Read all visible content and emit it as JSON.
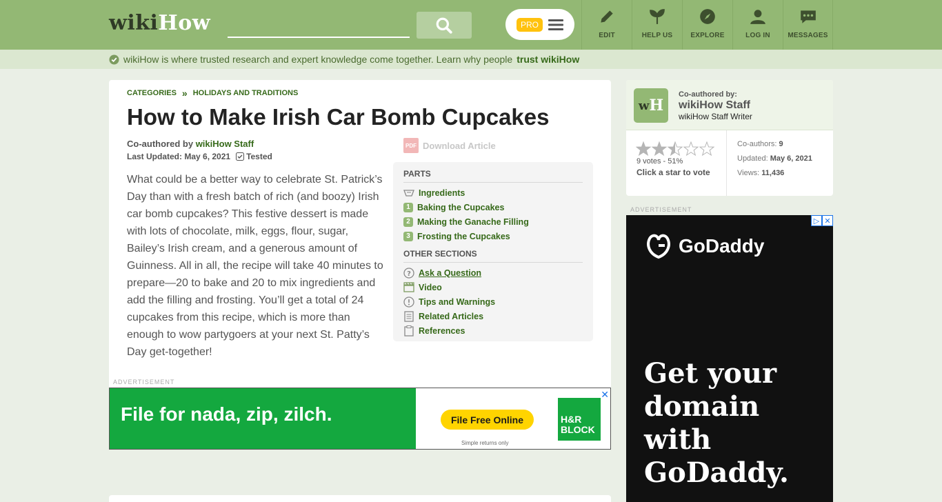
{
  "header": {
    "logo_wiki": "wiki",
    "logo_how": "How",
    "pro_label": "PRO",
    "nav": [
      {
        "label": "EDIT",
        "icon": "pencil-icon"
      },
      {
        "label": "HELP US",
        "icon": "sprout-icon"
      },
      {
        "label": "EXPLORE",
        "icon": "compass-icon"
      },
      {
        "label": "LOG IN",
        "icon": "user-icon"
      },
      {
        "label": "MESSAGES",
        "icon": "chat-icon"
      }
    ]
  },
  "trust_bar": {
    "text": "wikiHow is where trusted research and expert knowledge come together. Learn why people",
    "link": "trust wikiHow"
  },
  "article": {
    "breadcrumb": [
      "CATEGORIES",
      "HOLIDAYS AND TRADITIONS"
    ],
    "breadcrumb_sep": "»",
    "title": "How to Make Irish Car Bomb Cupcakes",
    "coauthored_label": "Co-authored by",
    "coauthor": "wikiHow Staff",
    "last_updated": "Last Updated: May 6, 2021",
    "tested": "Tested",
    "download": "Download Article",
    "pdf_badge": "PDF",
    "intro": "What could be a better way to celebrate St. Patrick’s Day than with a fresh batch of rich (and boozy) Irish car bomb cupcakes? This festive dessert is made with lots of chocolate, milk, eggs, flour, sugar, Bailey’s Irish cream, and a generous amount of Guinness. All in all, the recipe will take 40 minutes to prepare—20 to bake and 20 to mix ingredients and add the filling and frosting. You’ll get a total of 24 cupcakes from this recipe, which is more than enough to wow partygoers at your next St. Patty’s Day get-together!"
  },
  "toc": {
    "parts_heading": "PARTS",
    "parts": [
      {
        "label": "Ingredients",
        "marker": ""
      },
      {
        "label": "Baking the Cupcakes",
        "marker": "1"
      },
      {
        "label": "Making the Ganache Filling",
        "marker": "2"
      },
      {
        "label": "Frosting the Cupcakes",
        "marker": "3"
      }
    ],
    "other_heading": "OTHER SECTIONS",
    "other": [
      {
        "label": "Ask a Question",
        "icon": "question-icon"
      },
      {
        "label": "Video",
        "icon": "clapper-icon"
      },
      {
        "label": "Tips and Warnings",
        "icon": "warning-icon"
      },
      {
        "label": "Related Articles",
        "icon": "article-icon"
      },
      {
        "label": "References",
        "icon": "clipboard-icon"
      }
    ]
  },
  "ads": {
    "label": "ADVERTISEMENT",
    "hrblock": {
      "headline": "File for nada, zip, zilch.",
      "cta": "File Free Online",
      "sub": "Simple returns only",
      "logo_line1": "H&R",
      "logo_line2": "BLOCK"
    },
    "godaddy": {
      "brand": "GoDaddy",
      "headline_lines": [
        "Get your",
        "domain",
        "with",
        "GoDaddy."
      ]
    }
  },
  "sidebar": {
    "coauthored_label": "Co-authored by:",
    "name": "wikiHow Staff",
    "role": "wikiHow Staff Writer",
    "rating": {
      "filled": 2.5,
      "max": 5
    },
    "votes": "9 votes - 51%",
    "click_to_vote": "Click a star to vote",
    "coauthors_label": "Co-authors:",
    "coauthors": "9",
    "updated_label": "Updated:",
    "updated": "May 6, 2021",
    "views_label": "Views:",
    "views": "11,436"
  },
  "colors": {
    "brand_green": "#93b874",
    "link_green": "#366919",
    "pro_yellow": "#ffc20e"
  }
}
